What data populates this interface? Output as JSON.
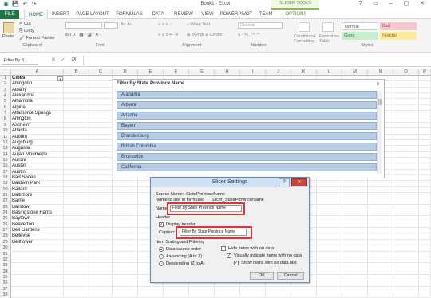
{
  "window": {
    "title": "Book1 - Excel",
    "context_tab": "SLICER TOOLS"
  },
  "tabs": [
    "FILE",
    "HOME",
    "INSERT",
    "PAGE LAYOUT",
    "FORMULAS",
    "DATA",
    "REVIEW",
    "VIEW",
    "POWERPIVOT",
    "TEAM",
    "OPTIONS"
  ],
  "ribbon": {
    "clipboard": {
      "paste": "Paste",
      "cut": "Cut",
      "copy": "Copy",
      "format_painter": "Format Painter",
      "label": "Clipboard"
    },
    "font": {
      "label": "Font"
    },
    "alignment": {
      "wrap": "Wrap Text",
      "merge": "Merge & Center",
      "label": "Alignment"
    },
    "number": {
      "format": "General",
      "label": "Number"
    },
    "styles": {
      "cond": "Conditional Formatting",
      "table": "Format as Table",
      "normal": "Normal",
      "bad": "Bad",
      "good": "Good",
      "neutral": "Neutral",
      "label": "Styles"
    }
  },
  "formula_bar": {
    "name_box": "Filter By S...",
    "fx": "fx"
  },
  "columns": [
    "A",
    "B",
    "C",
    "D",
    "E",
    "F",
    "G",
    "H",
    "I",
    "J",
    "K",
    "L",
    "M",
    "N",
    "O",
    "P"
  ],
  "rows": {
    "numbers": [
      "1",
      "2",
      "3",
      "4",
      "5",
      "6",
      "7",
      "8",
      "9",
      "10",
      "11",
      "12",
      "13",
      "14",
      "15",
      "16",
      "17",
      "18",
      "19",
      "20",
      "21",
      "22",
      "23",
      "24",
      "25",
      "26",
      "27",
      "28",
      "29",
      "30",
      "31",
      "32",
      "33",
      "34",
      "35",
      "36",
      "37",
      "38"
    ],
    "cells": [
      "Cities",
      "Abingdon",
      "Albany",
      "Alexandria",
      "Alhambra",
      "Alpine",
      "Altamonte Springs",
      "Arlington",
      "Ascheim",
      "Atlanta",
      "Auburn",
      "Augsburg",
      "Augusta",
      "Aujan Mournede",
      "Aurora",
      "Austell",
      "Austin",
      "Bad Soden",
      "Baldwin Park",
      "Ballard",
      "Baltimore",
      "Barrie",
      "Barstow",
      "Basingstoke Hants",
      "Baytown",
      "Beaverton",
      "Bell Gardens",
      "Bellevue",
      "Bellflower"
    ]
  },
  "slicer": {
    "header": "Filter By State Province Name",
    "items": [
      "Alabama",
      "Alberta",
      "Arizona",
      "Bayern",
      "Brandenburg",
      "British Columbia",
      "Brunswick",
      "California"
    ]
  },
  "dialog": {
    "title": "Slicer Settings",
    "help": "?",
    "close": "✕",
    "source_label": "Source Name:",
    "source_value": "StateProvinceName",
    "formula_label": "Name to use in formulas:",
    "formula_value": "Slicer_StateProvinceName",
    "name_label": "Name:",
    "name_value": "Filter By State Province Name",
    "header_section": "Header",
    "display_header": "Display header",
    "caption_label": "Caption:",
    "caption_value": "Filter By State Province Name",
    "sorting_section": "Item Sorting and Filtering",
    "opt_source": "Data source order",
    "opt_asc": "Ascending (A to Z)",
    "opt_desc": "Descending (Z to A)",
    "hide_no_data": "Hide items with no data",
    "visual_no_data": "Visually indicate items with no data",
    "show_last": "Show items with no data last",
    "ok": "OK",
    "cancel": "Cancel"
  },
  "colors": {
    "excel_green": "#217346",
    "slicer_item": "#b8cce4",
    "highlight": "#d9343c"
  }
}
